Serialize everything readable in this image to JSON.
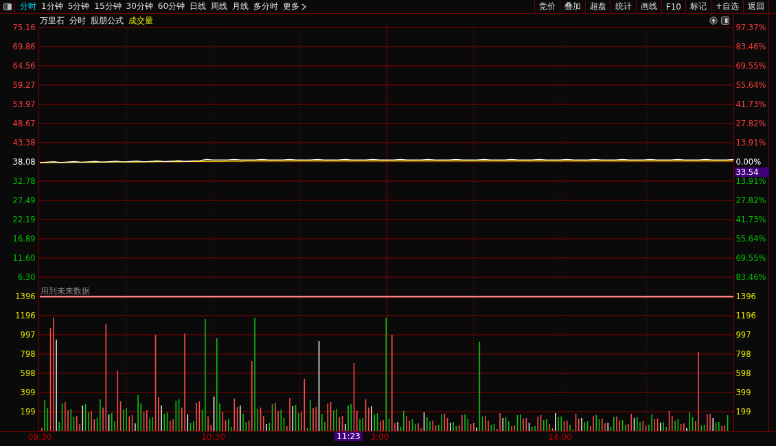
{
  "toolbar": {
    "tabs": [
      {
        "label": "分时",
        "selected": true
      },
      {
        "label": "1分钟",
        "selected": false
      },
      {
        "label": "5分钟",
        "selected": false
      },
      {
        "label": "15分钟",
        "selected": false
      },
      {
        "label": "30分钟",
        "selected": false
      },
      {
        "label": "60分钟",
        "selected": false
      },
      {
        "label": "日线",
        "selected": false
      },
      {
        "label": "周线",
        "selected": false
      },
      {
        "label": "月线",
        "selected": false
      },
      {
        "label": "多分时",
        "selected": false
      }
    ],
    "more": "更多",
    "buttons": [
      "竞价",
      "叠加",
      "超盘",
      "统计",
      "画线",
      "F10",
      "标记",
      "+自选",
      "返回"
    ]
  },
  "chart": {
    "stock": "万里石",
    "labels": [
      "分时",
      "股朋公式"
    ],
    "indicator": "成交量",
    "price_ticks": [
      {
        "label": "75.16",
        "kind": "up"
      },
      {
        "label": "69.86",
        "kind": "up"
      },
      {
        "label": "64.56",
        "kind": "up"
      },
      {
        "label": "59.27",
        "kind": "up"
      },
      {
        "label": "53.97",
        "kind": "up"
      },
      {
        "label": "48.67",
        "kind": "up"
      },
      {
        "label": "43.38",
        "kind": "up"
      },
      {
        "label": "38.08",
        "kind": "flat"
      },
      {
        "label": "32.78",
        "kind": "down"
      },
      {
        "label": "27.49",
        "kind": "down"
      },
      {
        "label": "22.19",
        "kind": "down"
      },
      {
        "label": "16.89",
        "kind": "down"
      },
      {
        "label": "11.60",
        "kind": "down"
      },
      {
        "label": "6.30",
        "kind": "down"
      }
    ],
    "pct_ticks": [
      {
        "label": "97.37%",
        "kind": "up"
      },
      {
        "label": "83.46%",
        "kind": "up"
      },
      {
        "label": "69.55%",
        "kind": "up"
      },
      {
        "label": "55.64%",
        "kind": "up"
      },
      {
        "label": "41.73%",
        "kind": "up"
      },
      {
        "label": "27.82%",
        "kind": "up"
      },
      {
        "label": "13.91%",
        "kind": "up"
      },
      {
        "label": "0.00%",
        "kind": "flat"
      },
      {
        "label": "13.91%",
        "kind": "down"
      },
      {
        "label": "27.82%",
        "kind": "down"
      },
      {
        "label": "41.73%",
        "kind": "down"
      },
      {
        "label": "55.64%",
        "kind": "down"
      },
      {
        "label": "69.55%",
        "kind": "down"
      },
      {
        "label": "83.46%",
        "kind": "down"
      }
    ],
    "cursor_price": "33.54",
    "warning": "用到未来数据",
    "left_volume_ticks": [
      "1396",
      "1196",
      "997",
      "798",
      "598",
      "399",
      "199"
    ],
    "right_volume_ticks": [
      "1396",
      "1196",
      "997",
      "798",
      "598",
      "399",
      "199"
    ],
    "time_ticks": [
      "09:30",
      "10:30",
      "3:00",
      "14:00"
    ],
    "cursor_time": "11:23"
  }
}
